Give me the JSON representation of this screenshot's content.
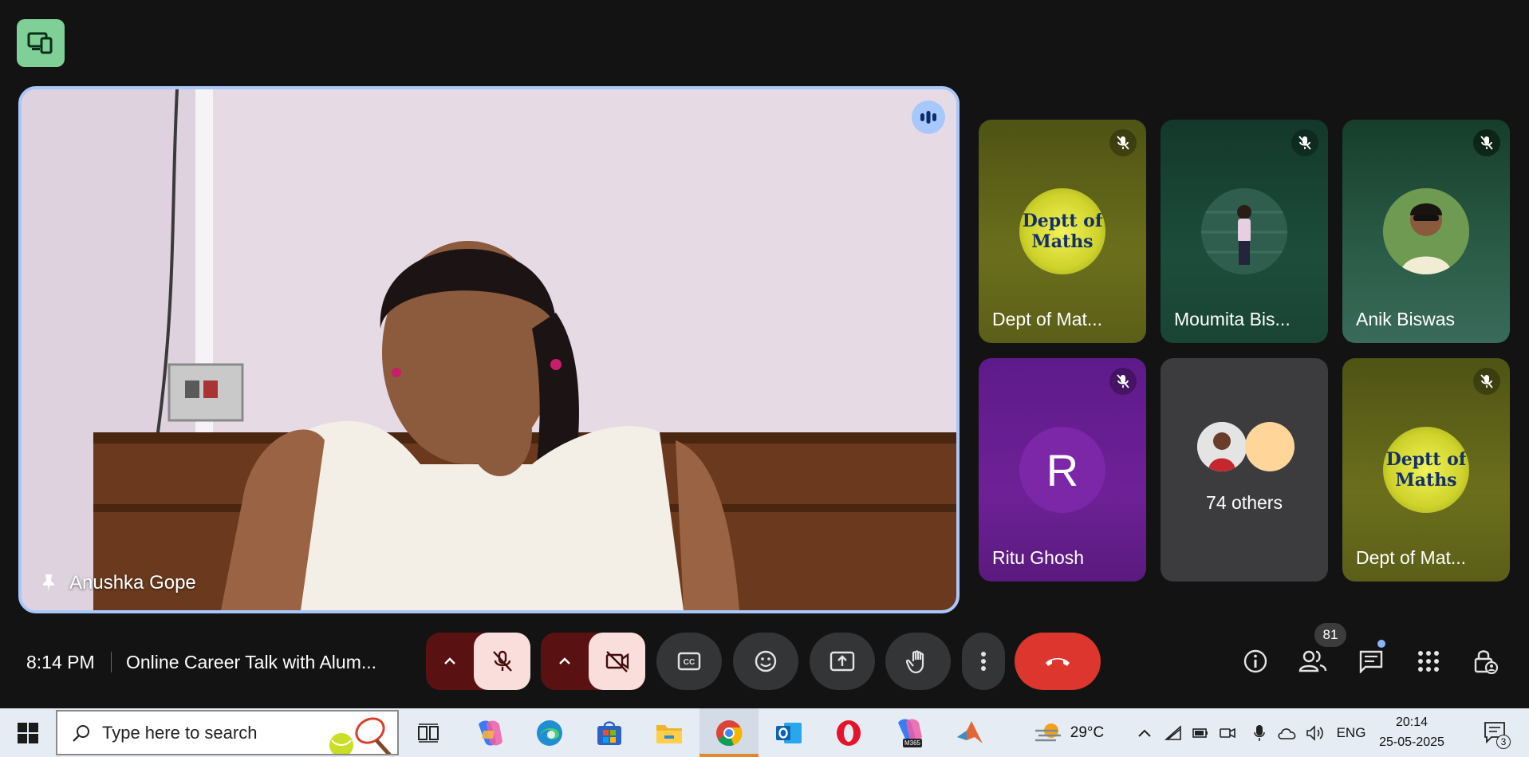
{
  "meeting": {
    "time": "8:14 PM",
    "title": "Online Career Talk with Alum...",
    "participant_count": "81"
  },
  "main_speaker": {
    "name": "Anushka Gope"
  },
  "tiles": [
    {
      "name": "Dept of Mat...",
      "avatar_text": "Deptt of Maths",
      "muted": true
    },
    {
      "name": "Moumita Bis...",
      "muted": true
    },
    {
      "name": "Anik Biswas",
      "muted": true
    },
    {
      "name": "Ritu Ghosh",
      "avatar_letter": "R",
      "muted": true
    },
    {
      "name": "74 others"
    },
    {
      "name": "Dept of Mat...",
      "avatar_text": "Deptt of Maths",
      "muted": true
    }
  ],
  "taskbar": {
    "search_placeholder": "Type here to search",
    "weather": "29°C",
    "language": "ENG",
    "clock_time": "20:14",
    "clock_date": "25-05-2025",
    "notification_count": "3"
  },
  "colors": {
    "accent_border": "#a8c7fa",
    "end_call": "#dc362e",
    "muted_btn_bg": "#f9dedc",
    "muted_group_bg": "#5a1111"
  }
}
